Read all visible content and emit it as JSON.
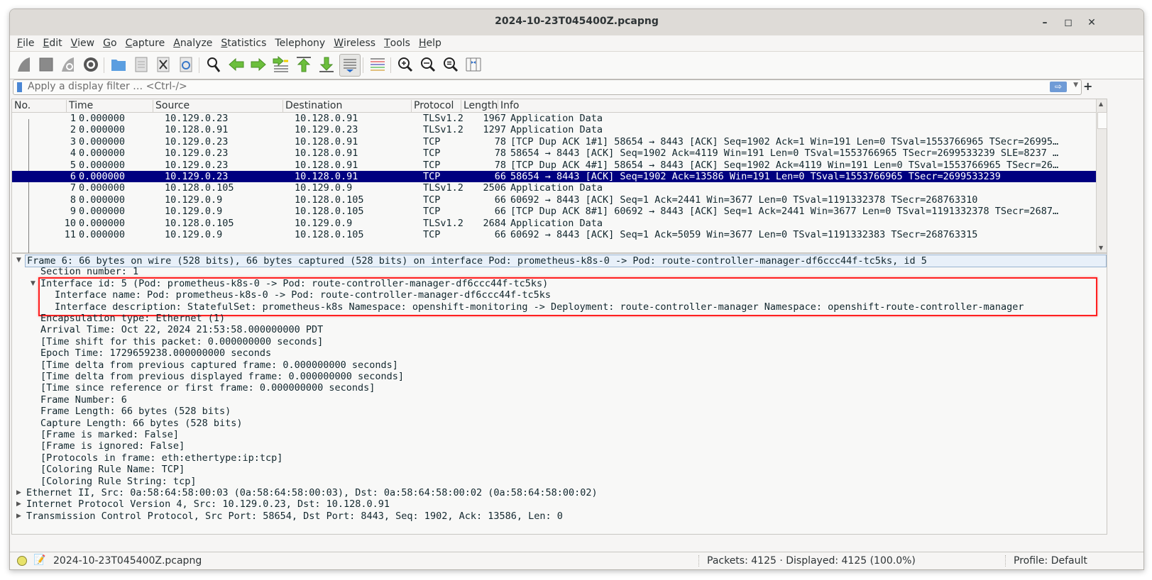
{
  "window": {
    "title": "2024-10-23T045400Z.pcapng",
    "controls": {
      "minimize": "–",
      "maximize": "◻",
      "close": "✕"
    }
  },
  "menu": [
    {
      "label": "File",
      "mnemonic": "F",
      "rest": "ile"
    },
    {
      "label": "Edit",
      "mnemonic": "E",
      "rest": "dit"
    },
    {
      "label": "View",
      "mnemonic": "V",
      "rest": "iew"
    },
    {
      "label": "Go",
      "mnemonic": "G",
      "rest": "o"
    },
    {
      "label": "Capture",
      "mnemonic": "C",
      "rest": "apture"
    },
    {
      "label": "Analyze",
      "mnemonic": "A",
      "rest": "nalyze"
    },
    {
      "label": "Statistics",
      "mnemonic": "S",
      "rest": "tatistics"
    },
    {
      "label": "Telephony",
      "mnemonic": "",
      "rest": "Telephony"
    },
    {
      "label": "Wireless",
      "mnemonic": "W",
      "rest": "ireless"
    },
    {
      "label": "Tools",
      "mnemonic": "T",
      "rest": "ools"
    },
    {
      "label": "Help",
      "mnemonic": "H",
      "rest": "elp"
    }
  ],
  "toolbar": [
    "start-capture-icon",
    "stop-capture-icon",
    "restart-capture-icon",
    "capture-options-icon",
    "open-file-icon",
    "save-file-icon",
    "close-file-icon",
    "reload-file-icon",
    "find-packet-icon",
    "go-back-icon",
    "go-forward-icon",
    "go-to-packet-icon",
    "go-first-icon",
    "go-last-icon",
    "autoscroll-icon",
    "colorize-icon",
    "zoom-in-icon",
    "zoom-out-icon",
    "zoom-normal-icon",
    "resize-columns-icon"
  ],
  "filter": {
    "placeholder": "Apply a display filter … <Ctrl-/>",
    "value": "",
    "apply_icon": "⇨",
    "add_label": "+"
  },
  "packet_list": {
    "columns": [
      "No.",
      "Time",
      "Source",
      "Destination",
      "Protocol",
      "Length",
      "Info"
    ],
    "selected_index": 5,
    "rows": [
      {
        "no": "1",
        "time": "0.000000",
        "src": "10.129.0.23",
        "dst": "10.128.0.91",
        "proto": "TLSv1.2",
        "len": "1967",
        "info": "Application Data"
      },
      {
        "no": "2",
        "time": "0.000000",
        "src": "10.128.0.91",
        "dst": "10.129.0.23",
        "proto": "TLSv1.2",
        "len": "1297",
        "info": "Application Data"
      },
      {
        "no": "3",
        "time": "0.000000",
        "src": "10.129.0.23",
        "dst": "10.128.0.91",
        "proto": "TCP",
        "len": "78",
        "info": "[TCP Dup ACK 1#1] 58654 → 8443 [ACK] Seq=1902 Ack=1 Win=191 Len=0 TSval=1553766965 TSecr=26995…"
      },
      {
        "no": "4",
        "time": "0.000000",
        "src": "10.129.0.23",
        "dst": "10.128.0.91",
        "proto": "TCP",
        "len": "78",
        "info": "58654 → 8443 [ACK] Seq=1902 Ack=4119 Win=191 Len=0 TSval=1553766965 TSecr=2699533239 SLE=8237 …"
      },
      {
        "no": "5",
        "time": "0.000000",
        "src": "10.129.0.23",
        "dst": "10.128.0.91",
        "proto": "TCP",
        "len": "78",
        "info": "[TCP Dup ACK 4#1] 58654 → 8443 [ACK] Seq=1902 Ack=4119 Win=191 Len=0 TSval=1553766965 TSecr=26…"
      },
      {
        "no": "6",
        "time": "0.000000",
        "src": "10.129.0.23",
        "dst": "10.128.0.91",
        "proto": "TCP",
        "len": "66",
        "info": "58654 → 8443 [ACK] Seq=1902 Ack=13586 Win=191 Len=0 TSval=1553766965 TSecr=2699533239"
      },
      {
        "no": "7",
        "time": "0.000000",
        "src": "10.128.0.105",
        "dst": "10.129.0.9",
        "proto": "TLSv1.2",
        "len": "2506",
        "info": "Application Data"
      },
      {
        "no": "8",
        "time": "0.000000",
        "src": "10.129.0.9",
        "dst": "10.128.0.105",
        "proto": "TCP",
        "len": "66",
        "info": "60692 → 8443 [ACK] Seq=1 Ack=2441 Win=3677 Len=0 TSval=1191332378 TSecr=268763310"
      },
      {
        "no": "9",
        "time": "0.000000",
        "src": "10.129.0.9",
        "dst": "10.128.0.105",
        "proto": "TCP",
        "len": "66",
        "info": "[TCP Dup ACK 8#1] 60692 → 8443 [ACK] Seq=1 Ack=2441 Win=3677 Len=0 TSval=1191332378 TSecr=2687…"
      },
      {
        "no": "10",
        "time": "0.000000",
        "src": "10.128.0.105",
        "dst": "10.129.0.9",
        "proto": "TLSv1.2",
        "len": "2684",
        "info": "Application Data"
      },
      {
        "no": "11",
        "time": "0.000000",
        "src": "10.129.0.9",
        "dst": "10.128.0.105",
        "proto": "TCP",
        "len": "66",
        "info": "60692 → 8443 [ACK] Seq=1 Ack=5059 Win=3677 Len=0 TSval=1191332383 TSecr=268763315"
      }
    ]
  },
  "details": [
    {
      "level": 0,
      "expander": "expanded",
      "text": "Frame 6: 66 bytes on wire (528 bits), 66 bytes captured (528 bits) on interface Pod: prometheus-k8s-0 -> Pod: route-controller-manager-df6ccc44f-tc5ks, id 5",
      "highlight": true
    },
    {
      "level": 1,
      "expander": "none",
      "text": "Section number: 1"
    },
    {
      "level": 1,
      "expander": "expanded",
      "text": "Interface id: 5 (Pod: prometheus-k8s-0 -> Pod: route-controller-manager-df6ccc44f-tc5ks)"
    },
    {
      "level": 2,
      "expander": "none",
      "text": "Interface name: Pod: prometheus-k8s-0 -> Pod: route-controller-manager-df6ccc44f-tc5ks"
    },
    {
      "level": 2,
      "expander": "none",
      "text": "Interface description: StatefulSet: prometheus-k8s Namespace: openshift-monitoring -> Deployment: route-controller-manager Namespace: openshift-route-controller-manager"
    },
    {
      "level": 1,
      "expander": "none",
      "text": "Encapsulation type: Ethernet (1)"
    },
    {
      "level": 1,
      "expander": "none",
      "text": "Arrival Time: Oct 22, 2024 21:53:58.000000000 PDT"
    },
    {
      "level": 1,
      "expander": "none",
      "text": "[Time shift for this packet: 0.000000000 seconds]"
    },
    {
      "level": 1,
      "expander": "none",
      "text": "Epoch Time: 1729659238.000000000 seconds"
    },
    {
      "level": 1,
      "expander": "none",
      "text": "[Time delta from previous captured frame: 0.000000000 seconds]"
    },
    {
      "level": 1,
      "expander": "none",
      "text": "[Time delta from previous displayed frame: 0.000000000 seconds]"
    },
    {
      "level": 1,
      "expander": "none",
      "text": "[Time since reference or first frame: 0.000000000 seconds]"
    },
    {
      "level": 1,
      "expander": "none",
      "text": "Frame Number: 6"
    },
    {
      "level": 1,
      "expander": "none",
      "text": "Frame Length: 66 bytes (528 bits)"
    },
    {
      "level": 1,
      "expander": "none",
      "text": "Capture Length: 66 bytes (528 bits)"
    },
    {
      "level": 1,
      "expander": "none",
      "text": "[Frame is marked: False]"
    },
    {
      "level": 1,
      "expander": "none",
      "text": "[Frame is ignored: False]"
    },
    {
      "level": 1,
      "expander": "none",
      "text": "[Protocols in frame: eth:ethertype:ip:tcp]"
    },
    {
      "level": 1,
      "expander": "none",
      "text": "[Coloring Rule Name: TCP]"
    },
    {
      "level": 1,
      "expander": "none",
      "text": "[Coloring Rule String: tcp]"
    },
    {
      "level": 0,
      "expander": "collapsed",
      "text": "Ethernet II, Src: 0a:58:64:58:00:03 (0a:58:64:58:00:03), Dst: 0a:58:64:58:00:02 (0a:58:64:58:00:02)"
    },
    {
      "level": 0,
      "expander": "collapsed",
      "text": "Internet Protocol Version 4, Src: 10.129.0.23, Dst: 10.128.0.91"
    },
    {
      "level": 0,
      "expander": "collapsed",
      "text": "Transmission Control Protocol, Src Port: 58654, Dst Port: 8443, Seq: 1902, Ack: 13586, Len: 0"
    }
  ],
  "annotation": {
    "highlight_color": "#ff2020",
    "covers_detail_rows": [
      2,
      3,
      4
    ]
  },
  "status": {
    "file": "2024-10-23T045400Z.pcapng",
    "packets": "Packets: 4125 · Displayed: 4125 (100.0%)",
    "profile": "Profile: Default"
  },
  "colors": {
    "selection": "#000080",
    "frame_highlight": "#e8f0f9",
    "status_led": "#e8e26a"
  }
}
